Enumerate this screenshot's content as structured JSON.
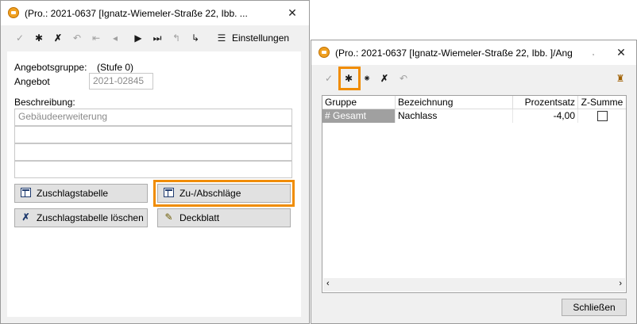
{
  "colors": {
    "highlight": "#f08c00",
    "selected_cell": "#a0a0a0"
  },
  "win1": {
    "title": "(Pro.: 2021-0637 [Ignatz-Wiemeler-Straße 22, Ibb. ...",
    "toolbar_icons": [
      "confirm-icon",
      "new-icon",
      "delete-icon",
      "undo-icon",
      "first-icon",
      "prev-icon",
      "next-icon",
      "last-icon",
      "jump-back-icon",
      "jump-icon"
    ],
    "settings_label": "Einstellungen",
    "group_label": "Angebotsgruppe:",
    "group_value": "(Stufe 0)",
    "offer_label": "Angebot",
    "offer_value": "2021-02845",
    "desc_label": "Beschreibung:",
    "desc_lines": [
      "Gebäudeerweiterung",
      "",
      "",
      ""
    ],
    "btn_surcharge_table": "Zuschlagstabelle",
    "btn_surcharges": "Zu-/Abschläge",
    "btn_delete_table": "Zuschlagstabelle löschen",
    "btn_cover": "Deckblatt"
  },
  "win2": {
    "title": "(Pro.: 2021-0637 [Ignatz-Wiemeler-Straße 22, Ibb. ]/Ang",
    "columns": [
      "Gruppe",
      "Bezeichnung",
      "Prozentsatz",
      "Z-Summe"
    ],
    "rows": [
      {
        "gruppe": "# Gesamt",
        "bezeichnung": "Nachlass",
        "prozentsatz": "-4,00",
        "zsumme": false
      }
    ],
    "close_label": "Schließen"
  }
}
